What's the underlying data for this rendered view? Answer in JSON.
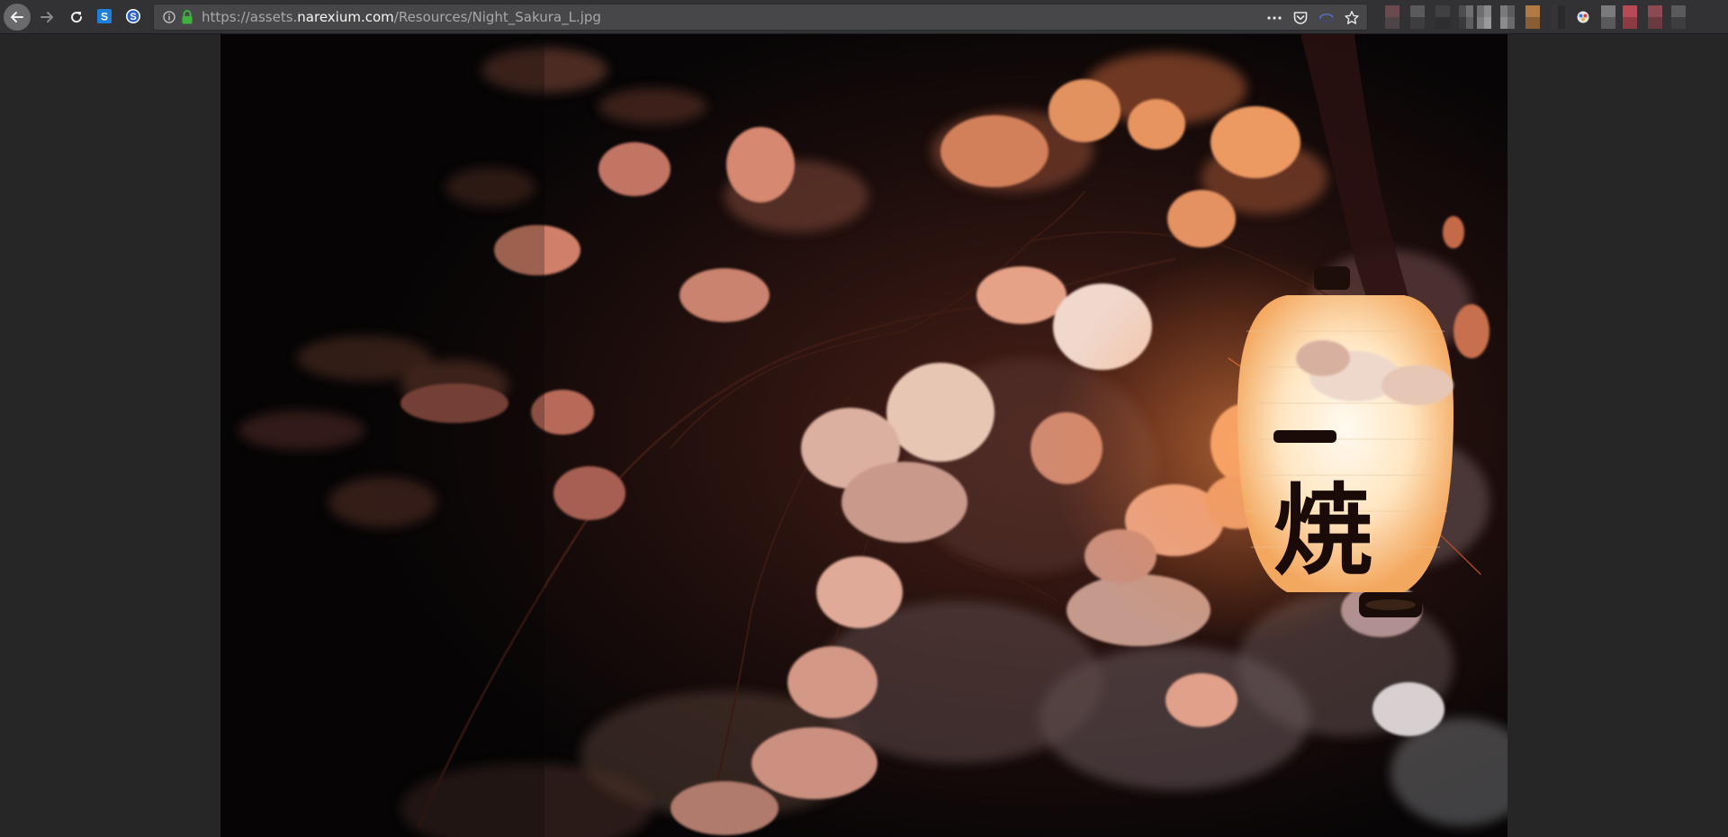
{
  "toolbar": {
    "nav": {
      "back_icon": "arrow-left-icon",
      "forward_icon": "arrow-right-icon",
      "reload_icon": "reload-icon"
    },
    "extensions": [
      {
        "icon": "s-square-extension-icon",
        "color": "#1e7fd6"
      },
      {
        "icon": "s-circle-extension-icon",
        "color": "#2b62c9"
      }
    ],
    "url": {
      "prefix": "https://assets.",
      "host": "narexium.com",
      "path": "/Resources/Night_Sakura_L.jpg"
    },
    "url_actions": [
      "more-icon",
      "pocket-icon",
      "sync-icon",
      "bookmark-star-icon"
    ],
    "colors": {
      "toolbar_bg": "#323234",
      "url_bg": "#474749",
      "lock_green": "#3fb13f",
      "page_bg": "#262626"
    }
  },
  "image": {
    "lantern_text": "焼"
  }
}
